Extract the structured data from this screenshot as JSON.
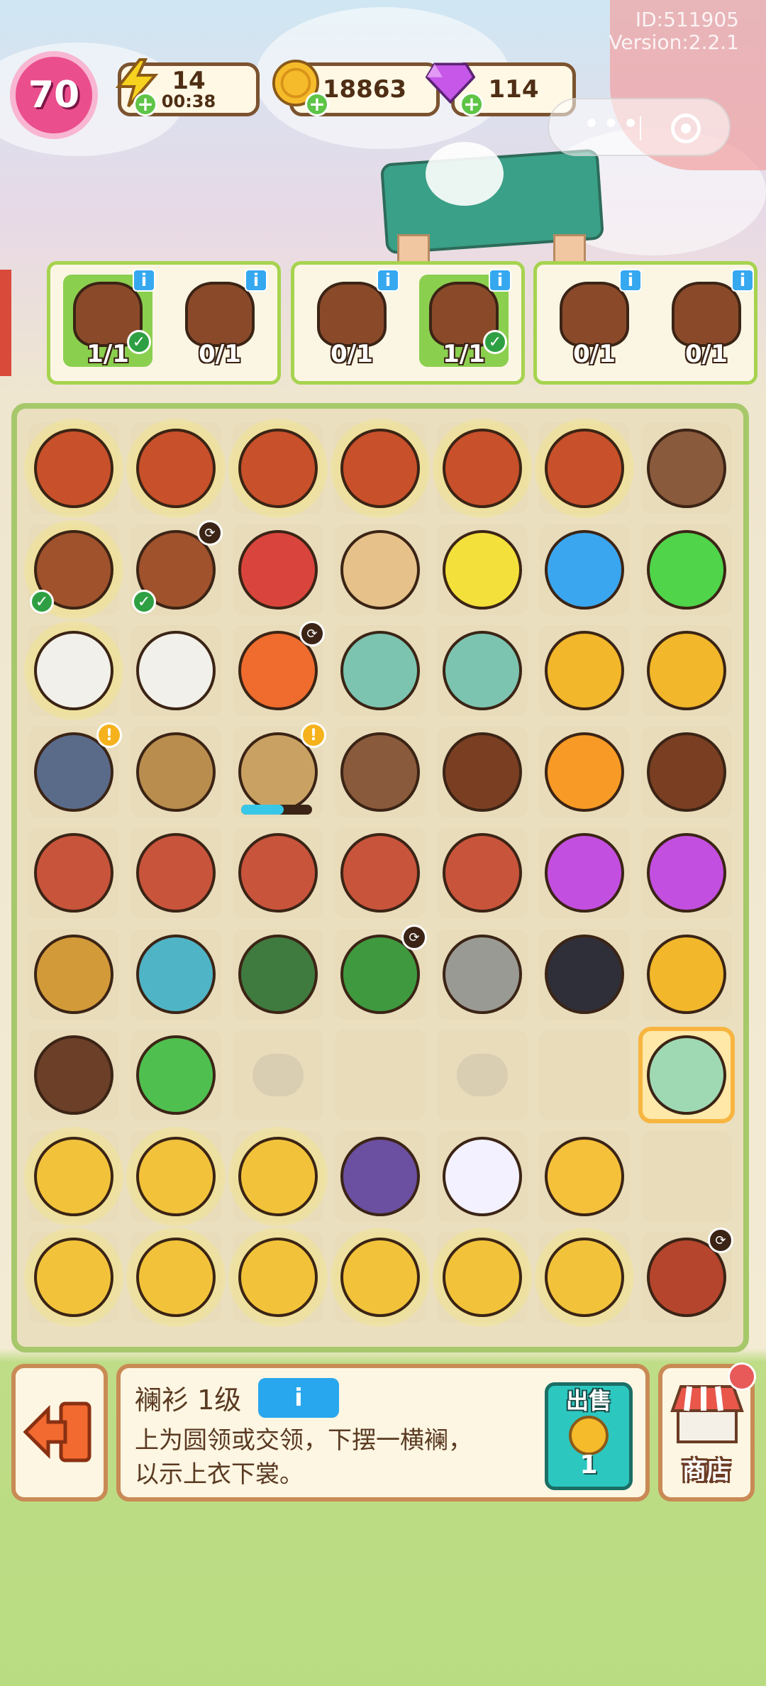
{
  "meta": {
    "id_text": "ID:511905",
    "version_text": "Version:2.2.1"
  },
  "player": {
    "level": "70"
  },
  "resources": {
    "energy": {
      "value": "14",
      "timer": "00:38",
      "icon": "lightning-icon"
    },
    "coins": {
      "value": "18863",
      "icon": "coin-icon"
    },
    "gems": {
      "value": "114",
      "icon": "gem-icon"
    },
    "plus_symbol": "+"
  },
  "capsule": {
    "more_icon": "more-dots-icon",
    "close_icon": "target-circle-icon"
  },
  "orders": [
    {
      "items": [
        {
          "icon": "wine-jar-icon",
          "count": "1/1",
          "done": true
        },
        {
          "icon": "scroll-icon",
          "count": "0/1",
          "done": false
        }
      ]
    },
    {
      "items": [
        {
          "icon": "red-cabinet-icon",
          "count": "0/1",
          "done": false
        },
        {
          "icon": "wine-jar-icon",
          "count": "1/1",
          "done": true
        }
      ]
    },
    {
      "items": [
        {
          "icon": "wood-chest-icon",
          "count": "0/1",
          "done": false
        },
        {
          "icon": "rice-sack-icon",
          "count": "0/1",
          "done": false
        }
      ]
    }
  ],
  "order_info_label": "i",
  "board": {
    "rows": [
      [
        {
          "icon": "zongzi-bag-icon",
          "glow": true,
          "color": "#c8502a"
        },
        {
          "icon": "zongzi-bag-icon",
          "glow": true,
          "color": "#c8502a"
        },
        {
          "icon": "zongzi-bag-icon",
          "glow": true,
          "color": "#c8502a"
        },
        {
          "icon": "zongzi-bag-icon",
          "glow": true,
          "color": "#c8502a"
        },
        {
          "icon": "zongzi-bag-icon",
          "glow": true,
          "color": "#c8502a"
        },
        {
          "icon": "zongzi-bag-icon",
          "glow": true,
          "color": "#c8502a"
        },
        {
          "icon": "mushroom-icon",
          "color": "#8a5a3c"
        }
      ],
      [
        {
          "icon": "wine-jar-icon",
          "glow": true,
          "check": true,
          "color": "#a0522d"
        },
        {
          "icon": "wine-jar-icon",
          "clock": true,
          "check": true,
          "color": "#a0522d"
        },
        {
          "icon": "drum-icon",
          "color": "#d9453c"
        },
        {
          "icon": "tambourine-icon",
          "color": "#e6c28a"
        },
        {
          "icon": "yellow-energy-orb-icon",
          "color": "#f4e03a"
        },
        {
          "icon": "blue-energy-orb-icon",
          "color": "#3aa6f0"
        },
        {
          "icon": "green-energy-orb-icon",
          "color": "#4fd44a"
        }
      ],
      [
        {
          "icon": "white-robe-icon",
          "glow": true,
          "color": "#f2f0ea"
        },
        {
          "icon": "white-robe-icon",
          "color": "#f2f0ea"
        },
        {
          "icon": "koi-fish-icon",
          "clock": true,
          "color": "#ef6c2e"
        },
        {
          "icon": "hanfu-dress-icon",
          "color": "#7cc4b0"
        },
        {
          "icon": "hanfu-dress-icon",
          "color": "#7cc4b0"
        },
        {
          "icon": "coin-pile-icon",
          "color": "#f2b72a"
        },
        {
          "icon": "coin-pile-icon",
          "color": "#f2b72a"
        }
      ],
      [
        {
          "icon": "cooking-stove-icon",
          "excl": true,
          "color": "#5a6b8a"
        },
        {
          "icon": "zongzi-basket-icon",
          "color": "#b98d4e"
        },
        {
          "icon": "bamboo-basket-icon",
          "excl": true,
          "progress": 0.6,
          "color": "#c9a163"
        },
        {
          "icon": "log-icon",
          "color": "#8a5a3c"
        },
        {
          "icon": "chestnut-icon",
          "color": "#7a3f22"
        },
        {
          "icon": "orange-energy-orb-icon",
          "color": "#f79a26"
        },
        {
          "icon": "chestnut-icon",
          "color": "#7a3f22"
        }
      ],
      [
        {
          "icon": "pork-meat-icon",
          "color": "#c9543c"
        },
        {
          "icon": "pork-meat-icon",
          "color": "#c9543c"
        },
        {
          "icon": "pork-meat-icon",
          "color": "#c9543c"
        },
        {
          "icon": "pork-meat-icon",
          "color": "#c9543c"
        },
        {
          "icon": "pork-meat-icon",
          "color": "#c9543c"
        },
        {
          "icon": "purple-energy-orb-icon",
          "color": "#c34fe0"
        },
        {
          "icon": "purple-energy-orb-icon",
          "color": "#c34fe0"
        }
      ],
      [
        {
          "icon": "paddle-icon",
          "color": "#d39a3a"
        },
        {
          "icon": "dragon-boat-icon",
          "color": "#4fb4c6"
        },
        {
          "icon": "rake-icon",
          "color": "#3f7a3f"
        },
        {
          "icon": "bamboo-leaves-icon",
          "clock": true,
          "color": "#3f9a3f"
        },
        {
          "icon": "stone-mill-icon",
          "color": "#9a9a94"
        },
        {
          "icon": "ink-bottle-icon",
          "color": "#2f2f3a"
        },
        {
          "icon": "coin-pile-icon",
          "color": "#f2b72a"
        }
      ],
      [
        {
          "icon": "wood-root-icon",
          "color": "#6b3f28"
        },
        {
          "icon": "bamboo-shoot-icon",
          "color": "#4fbf4f"
        },
        {
          "icon": "empty-locked",
          "ghost": true
        },
        {
          "icon": "empty"
        },
        {
          "icon": "empty-locked",
          "ghost": true
        },
        {
          "icon": "empty"
        },
        {
          "icon": "green-robe-icon",
          "selected": true,
          "color": "#9fd9b4"
        }
      ],
      [
        {
          "icon": "kite-icon",
          "glow": true,
          "color": "#f2c33a"
        },
        {
          "icon": "kite-icon",
          "glow": true,
          "color": "#f2c33a"
        },
        {
          "icon": "kite-icon",
          "glow": true,
          "color": "#f2c33a"
        },
        {
          "icon": "rattle-drum-icon",
          "color": "#6b4fa0"
        },
        {
          "icon": "cream-jar-icon",
          "color": "#f3f1ff"
        },
        {
          "icon": "hourglass-icon",
          "color": "#f6c13a"
        },
        {
          "icon": "empty"
        }
      ],
      [
        {
          "icon": "kite-icon",
          "glow": true,
          "color": "#f2c33a"
        },
        {
          "icon": "kite-icon",
          "glow": true,
          "color": "#f2c33a"
        },
        {
          "icon": "kite-icon",
          "glow": true,
          "color": "#f2c33a"
        },
        {
          "icon": "kite-icon",
          "glow": true,
          "color": "#f2c33a"
        },
        {
          "icon": "kite-icon",
          "glow": true,
          "color": "#f2c33a"
        },
        {
          "icon": "kite-icon",
          "glow": true,
          "color": "#f2c33a"
        },
        {
          "icon": "market-stall-icon",
          "clock": true,
          "color": "#b5452d"
        }
      ]
    ]
  },
  "info_panel": {
    "title": "襕衫 1级",
    "tag": "i",
    "description": "上为圆领或交领，下摆一横襕，以示上衣下裳。",
    "sell_label": "出售",
    "sell_value": "1",
    "sell_icon": "coin-icon"
  },
  "shop": {
    "label": "商店",
    "icon": "shop-awning-icon"
  },
  "exit": {
    "icon": "exit-arrow-icon"
  },
  "status_glyphs": {
    "clock": "⟳",
    "excl": "!",
    "check": "✓"
  },
  "colors": {
    "accent_green": "#a6d34f",
    "panel_border": "#c98a55",
    "level_pink": "#ea4e8d"
  }
}
